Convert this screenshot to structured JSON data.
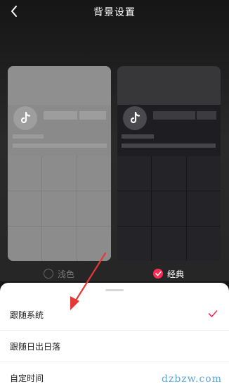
{
  "header": {
    "title": "背景设置",
    "back_icon": "chevron-left-icon"
  },
  "previews": [
    {
      "theme": "light",
      "label": "浅色",
      "selected": false,
      "logo_icon": "tiktok-logo-icon"
    },
    {
      "theme": "dark",
      "label": "经典",
      "selected": true,
      "logo_icon": "tiktok-logo-icon"
    }
  ],
  "sheet": {
    "items": [
      {
        "label": "跟随系统",
        "checked": true
      },
      {
        "label": "跟随日出日落",
        "checked": false
      },
      {
        "label": "自定时间",
        "checked": false
      }
    ]
  },
  "watermark": "dzbzw.com",
  "colors": {
    "accent": "#fe2c55",
    "annotation_arrow": "#e53935",
    "watermark": "#5aa8d8"
  }
}
